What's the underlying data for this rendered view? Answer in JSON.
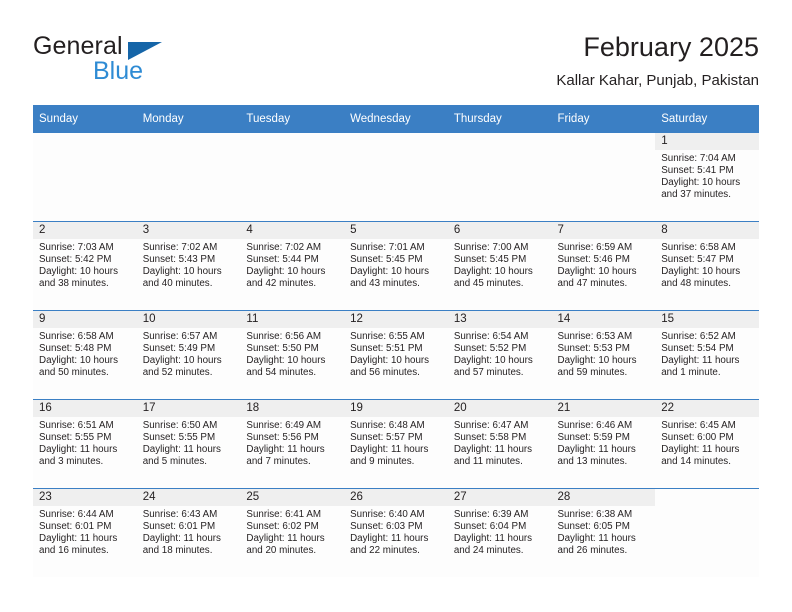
{
  "brand": {
    "name_dark": "General",
    "name_blue": "Blue",
    "accent_blue": "#2e8bd4",
    "triangle_blue": "#1565a8"
  },
  "header": {
    "title": "February 2025",
    "subtitle": "Kallar Kahar, Punjab, Pakistan"
  },
  "calendar": {
    "header_bg": "#3b7fc4",
    "datestrip_bg": "#efefef",
    "weekdays": [
      "Sunday",
      "Monday",
      "Tuesday",
      "Wednesday",
      "Thursday",
      "Friday",
      "Saturday"
    ],
    "weeks": [
      [
        {
          "day": "",
          "sunrise": "",
          "sunset": "",
          "daylight1": "",
          "daylight2": ""
        },
        {
          "day": "",
          "sunrise": "",
          "sunset": "",
          "daylight1": "",
          "daylight2": ""
        },
        {
          "day": "",
          "sunrise": "",
          "sunset": "",
          "daylight1": "",
          "daylight2": ""
        },
        {
          "day": "",
          "sunrise": "",
          "sunset": "",
          "daylight1": "",
          "daylight2": ""
        },
        {
          "day": "",
          "sunrise": "",
          "sunset": "",
          "daylight1": "",
          "daylight2": ""
        },
        {
          "day": "",
          "sunrise": "",
          "sunset": "",
          "daylight1": "",
          "daylight2": ""
        },
        {
          "day": "1",
          "sunrise": "Sunrise: 7:04 AM",
          "sunset": "Sunset: 5:41 PM",
          "daylight1": "Daylight: 10 hours",
          "daylight2": "and 37 minutes."
        }
      ],
      [
        {
          "day": "2",
          "sunrise": "Sunrise: 7:03 AM",
          "sunset": "Sunset: 5:42 PM",
          "daylight1": "Daylight: 10 hours",
          "daylight2": "and 38 minutes."
        },
        {
          "day": "3",
          "sunrise": "Sunrise: 7:02 AM",
          "sunset": "Sunset: 5:43 PM",
          "daylight1": "Daylight: 10 hours",
          "daylight2": "and 40 minutes."
        },
        {
          "day": "4",
          "sunrise": "Sunrise: 7:02 AM",
          "sunset": "Sunset: 5:44 PM",
          "daylight1": "Daylight: 10 hours",
          "daylight2": "and 42 minutes."
        },
        {
          "day": "5",
          "sunrise": "Sunrise: 7:01 AM",
          "sunset": "Sunset: 5:45 PM",
          "daylight1": "Daylight: 10 hours",
          "daylight2": "and 43 minutes."
        },
        {
          "day": "6",
          "sunrise": "Sunrise: 7:00 AM",
          "sunset": "Sunset: 5:45 PM",
          "daylight1": "Daylight: 10 hours",
          "daylight2": "and 45 minutes."
        },
        {
          "day": "7",
          "sunrise": "Sunrise: 6:59 AM",
          "sunset": "Sunset: 5:46 PM",
          "daylight1": "Daylight: 10 hours",
          "daylight2": "and 47 minutes."
        },
        {
          "day": "8",
          "sunrise": "Sunrise: 6:58 AM",
          "sunset": "Sunset: 5:47 PM",
          "daylight1": "Daylight: 10 hours",
          "daylight2": "and 48 minutes."
        }
      ],
      [
        {
          "day": "9",
          "sunrise": "Sunrise: 6:58 AM",
          "sunset": "Sunset: 5:48 PM",
          "daylight1": "Daylight: 10 hours",
          "daylight2": "and 50 minutes."
        },
        {
          "day": "10",
          "sunrise": "Sunrise: 6:57 AM",
          "sunset": "Sunset: 5:49 PM",
          "daylight1": "Daylight: 10 hours",
          "daylight2": "and 52 minutes."
        },
        {
          "day": "11",
          "sunrise": "Sunrise: 6:56 AM",
          "sunset": "Sunset: 5:50 PM",
          "daylight1": "Daylight: 10 hours",
          "daylight2": "and 54 minutes."
        },
        {
          "day": "12",
          "sunrise": "Sunrise: 6:55 AM",
          "sunset": "Sunset: 5:51 PM",
          "daylight1": "Daylight: 10 hours",
          "daylight2": "and 56 minutes."
        },
        {
          "day": "13",
          "sunrise": "Sunrise: 6:54 AM",
          "sunset": "Sunset: 5:52 PM",
          "daylight1": "Daylight: 10 hours",
          "daylight2": "and 57 minutes."
        },
        {
          "day": "14",
          "sunrise": "Sunrise: 6:53 AM",
          "sunset": "Sunset: 5:53 PM",
          "daylight1": "Daylight: 10 hours",
          "daylight2": "and 59 minutes."
        },
        {
          "day": "15",
          "sunrise": "Sunrise: 6:52 AM",
          "sunset": "Sunset: 5:54 PM",
          "daylight1": "Daylight: 11 hours",
          "daylight2": "and 1 minute."
        }
      ],
      [
        {
          "day": "16",
          "sunrise": "Sunrise: 6:51 AM",
          "sunset": "Sunset: 5:55 PM",
          "daylight1": "Daylight: 11 hours",
          "daylight2": "and 3 minutes."
        },
        {
          "day": "17",
          "sunrise": "Sunrise: 6:50 AM",
          "sunset": "Sunset: 5:55 PM",
          "daylight1": "Daylight: 11 hours",
          "daylight2": "and 5 minutes."
        },
        {
          "day": "18",
          "sunrise": "Sunrise: 6:49 AM",
          "sunset": "Sunset: 5:56 PM",
          "daylight1": "Daylight: 11 hours",
          "daylight2": "and 7 minutes."
        },
        {
          "day": "19",
          "sunrise": "Sunrise: 6:48 AM",
          "sunset": "Sunset: 5:57 PM",
          "daylight1": "Daylight: 11 hours",
          "daylight2": "and 9 minutes."
        },
        {
          "day": "20",
          "sunrise": "Sunrise: 6:47 AM",
          "sunset": "Sunset: 5:58 PM",
          "daylight1": "Daylight: 11 hours",
          "daylight2": "and 11 minutes."
        },
        {
          "day": "21",
          "sunrise": "Sunrise: 6:46 AM",
          "sunset": "Sunset: 5:59 PM",
          "daylight1": "Daylight: 11 hours",
          "daylight2": "and 13 minutes."
        },
        {
          "day": "22",
          "sunrise": "Sunrise: 6:45 AM",
          "sunset": "Sunset: 6:00 PM",
          "daylight1": "Daylight: 11 hours",
          "daylight2": "and 14 minutes."
        }
      ],
      [
        {
          "day": "23",
          "sunrise": "Sunrise: 6:44 AM",
          "sunset": "Sunset: 6:01 PM",
          "daylight1": "Daylight: 11 hours",
          "daylight2": "and 16 minutes."
        },
        {
          "day": "24",
          "sunrise": "Sunrise: 6:43 AM",
          "sunset": "Sunset: 6:01 PM",
          "daylight1": "Daylight: 11 hours",
          "daylight2": "and 18 minutes."
        },
        {
          "day": "25",
          "sunrise": "Sunrise: 6:41 AM",
          "sunset": "Sunset: 6:02 PM",
          "daylight1": "Daylight: 11 hours",
          "daylight2": "and 20 minutes."
        },
        {
          "day": "26",
          "sunrise": "Sunrise: 6:40 AM",
          "sunset": "Sunset: 6:03 PM",
          "daylight1": "Daylight: 11 hours",
          "daylight2": "and 22 minutes."
        },
        {
          "day": "27",
          "sunrise": "Sunrise: 6:39 AM",
          "sunset": "Sunset: 6:04 PM",
          "daylight1": "Daylight: 11 hours",
          "daylight2": "and 24 minutes."
        },
        {
          "day": "28",
          "sunrise": "Sunrise: 6:38 AM",
          "sunset": "Sunset: 6:05 PM",
          "daylight1": "Daylight: 11 hours",
          "daylight2": "and 26 minutes."
        },
        {
          "day": "",
          "sunrise": "",
          "sunset": "",
          "daylight1": "",
          "daylight2": ""
        }
      ]
    ]
  }
}
